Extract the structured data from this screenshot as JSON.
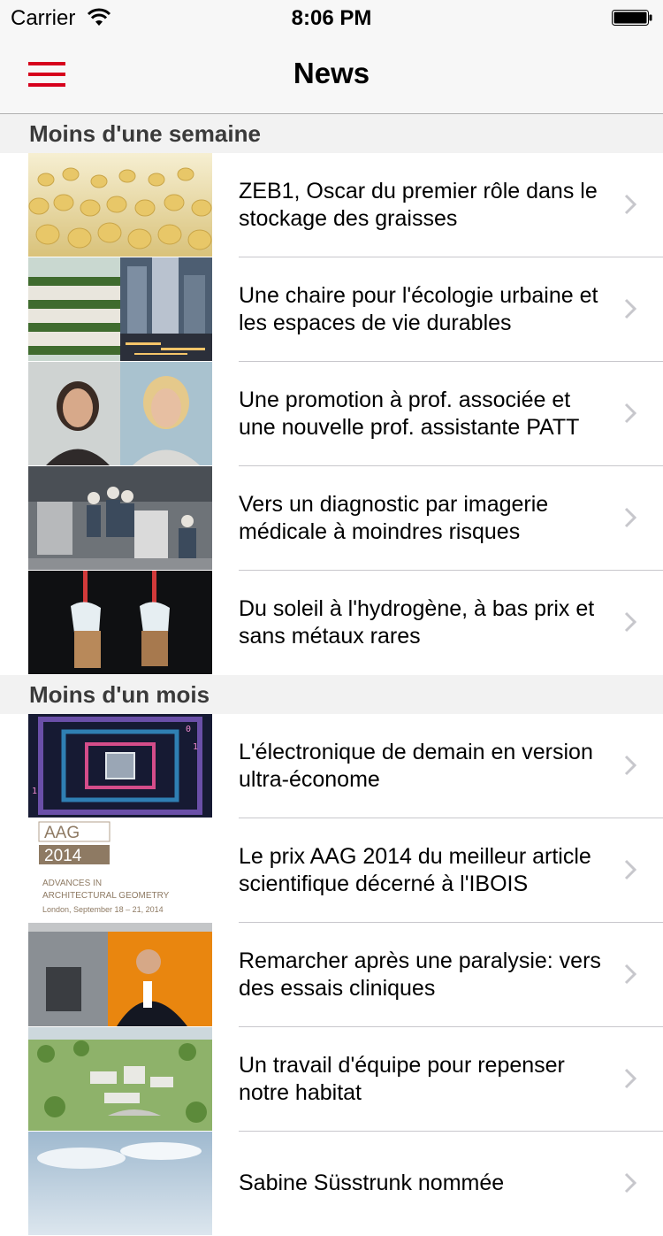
{
  "status_bar": {
    "carrier": "Carrier",
    "time": "8:06 PM"
  },
  "nav": {
    "title": "News",
    "menu_icon": "hamburger-icon"
  },
  "accent_color": "#d6001c",
  "sections": [
    {
      "header": "Moins d'une semaine",
      "items": [
        {
          "title": "ZEB1, Oscar du premier rôle dans le stockage des graisses"
        },
        {
          "title": "Une chaire pour l'écologie urbaine et les espaces de vie durables"
        },
        {
          "title": "Une promotion à prof. associée et une nouvelle prof. assistante PATT"
        },
        {
          "title": "Vers un diagnostic par imagerie médicale à moindres risques"
        },
        {
          "title": "Du soleil à l'hydrogène, à bas prix et sans métaux rares"
        }
      ]
    },
    {
      "header": "Moins d'un mois",
      "items": [
        {
          "title": "L'électronique de demain en version ultra-économe"
        },
        {
          "title": "Le prix AAG 2014 du meilleur article scientifique décerné à l'IBOIS"
        },
        {
          "title": "Remarcher après une paralysie: vers des essais cliniques"
        },
        {
          "title": "Un travail d'équipe pour repenser notre habitat"
        },
        {
          "title": "Sabine Süsstrunk nommée"
        }
      ]
    }
  ],
  "thumb_aag": {
    "line1": "AAG",
    "line2": "2014",
    "line3": "ADVANCES IN",
    "line4": "ARCHITECTURAL GEOMETRY",
    "line5": "London, September 18 – 21, 2014"
  }
}
